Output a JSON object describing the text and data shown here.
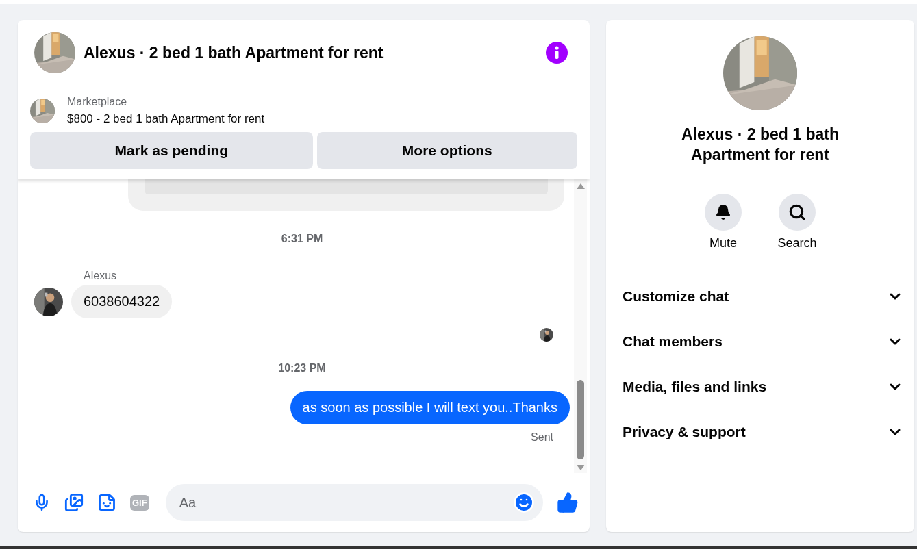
{
  "conversation": {
    "title": "Alexus · 2 bed 1 bath Apartment for rent"
  },
  "listing": {
    "source": "Marketplace",
    "title": "$800 - 2 bed 1 bath Apartment for rent",
    "actions": [
      "Mark as pending",
      "More options"
    ]
  },
  "messages": [
    {
      "kind": "time",
      "text": "6:31 PM"
    },
    {
      "kind": "incoming",
      "sender": "Alexus",
      "text": "6038604322"
    },
    {
      "kind": "read_receipt"
    },
    {
      "kind": "time",
      "text": "10:23 PM"
    },
    {
      "kind": "outgoing",
      "text": "as soon as possible I will text you..Thanks",
      "status": "Sent"
    }
  ],
  "composer": {
    "gif_label": "GIF",
    "placeholder": "Aa"
  },
  "details": {
    "title": "Alexus · 2 bed 1 bath Apartment for rent",
    "actions": [
      {
        "kind": "mute",
        "label": "Mute"
      },
      {
        "kind": "search",
        "label": "Search"
      }
    ],
    "sections": [
      {
        "label": "Customize chat",
        "expanded": false
      },
      {
        "label": "Chat members",
        "expanded": false
      },
      {
        "label": "Media, files and links",
        "expanded": false
      },
      {
        "label": "Privacy & support",
        "expanded": false
      }
    ]
  }
}
